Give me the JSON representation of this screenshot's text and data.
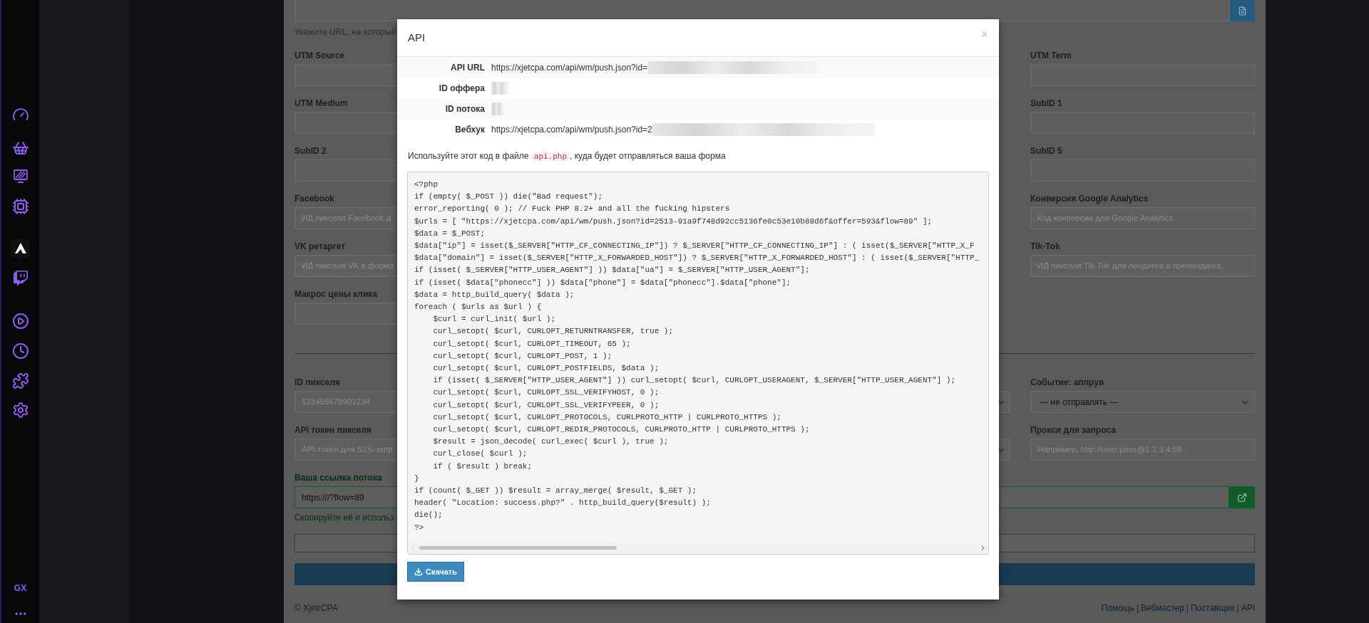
{
  "browser_sidebar": {
    "logo_text": "GX"
  },
  "page": {
    "top_field_hint": "Укажите URL, на который",
    "form_rows": [
      {
        "left": {
          "label": "UTM Source"
        },
        "right": {
          "label": "UTM Term"
        }
      },
      {
        "left": {
          "label": "UTM Medium"
        },
        "right": {
          "label": "SubID 1"
        }
      },
      {
        "left": {
          "label": "SubID 2"
        },
        "right": {
          "label": "SubID 5"
        }
      },
      {
        "left": {
          "label": "Facebook",
          "placeholder": "ИД пикселя Facebook д"
        },
        "right": {
          "label": "Конверсия Google Analytics",
          "placeholder": "Код конверсии для Google Analytics"
        }
      },
      {
        "left": {
          "label": "VK ретаргет",
          "placeholder": "ИД пикселя VK в форма"
        },
        "right": {
          "label": "Tik-Tok",
          "placeholder": "ИД пикселя Tik-Tok для лендинга и прелендинга."
        }
      },
      {
        "left": {
          "label": "Макрос цены клика"
        }
      }
    ],
    "pixel_rows": [
      {
        "left": {
          "label": "ID пикселя",
          "placeholder": "123455678901234"
        },
        "right": {
          "label": "Событие: аппрув",
          "kind": "select",
          "value": "— не отправлять —"
        }
      },
      {
        "left": {
          "label": "API токен пикселя",
          "placeholder": "API-токен для S2S-запр"
        },
        "right": {
          "label": "Прокси для запроса",
          "placeholder": "Например, http://user:pass@1.2.3.4:56"
        }
      }
    ],
    "flow_link": {
      "label": "Ваша ссылка потока",
      "value": "https:///?flow=89",
      "hint": "Скопируйте её и использ"
    },
    "footer": {
      "copyright": "© XjetrCPA",
      "separator": "|",
      "links": [
        "Помощь",
        "Вебмастер",
        "Поставщик",
        "API"
      ]
    }
  },
  "modal": {
    "title": "API",
    "close": "×",
    "fields": [
      {
        "label": "API URL",
        "value": "https://xjetcpa.com/api/wm/push.json?id=",
        "redacted": true
      },
      {
        "label": "ID оффера",
        "redacted": true
      },
      {
        "label": "ID потока",
        "redacted": true
      },
      {
        "label": "Вебхук",
        "value": "https://xjetcpa.com/api/wm/push.json?id=2",
        "redacted": true
      }
    ],
    "instruction": {
      "before": "Используйте этот код в файле",
      "code": "api.php",
      "after": ", куда будет отправляться ваша форма"
    },
    "code_lines": [
      "<?php",
      "if (empty( $_POST )) die(\"Bad request\");",
      "error_reporting( 0 ); // Fuck PHP 8.2+ and all the fucking hipsters",
      "$urls = [ \"https://xjetcpa.com/api/wm/push.json?id=2513-91a9f748d92cc5136fe0c53e10b88d6f&offer=593&flow=89\" ];",
      "$data = $_POST;",
      "$data[\"ip\"] = isset($_SERVER[\"HTTP_CF_CONNECTING_IP\"]) ? $_SERVER[\"HTTP_CF_CONNECTING_IP\"] : ( isset($_SERVER[\"HTTP_X_F",
      "$data[\"domain\"] = isset($_SERVER[\"HTTP_X_FORWARDED_HOST\"]) ? $_SERVER[\"HTTP_X_FORWARDED_HOST\"] : ( isset($_SERVER[\"HTTP_",
      "if (isset( $_SERVER[\"HTTP_USER_AGENT\"] )) $data[\"ua\"] = $_SERVER[\"HTTP_USER_AGENT\"];",
      "if (isset( $data[\"phonecc\"] )) $data[\"phone\"] = $data[\"phonecc\"].$data[\"phone\"];",
      "$data = http_build_query( $data );",
      "foreach ( $urls as $url ) {",
      "\t$curl = curl_init( $url );",
      "\tcurl_setopt( $curl, CURLOPT_RETURNTRANSFER, true );",
      "\tcurl_setopt( $curl, CURLOPT_TIMEOUT, 65 );",
      "\tcurl_setopt( $curl, CURLOPT_POST, 1 );",
      "\tcurl_setopt( $curl, CURLOPT_POSTFIELDS, $data );",
      "\tif (isset( $_SERVER[\"HTTP_USER_AGENT\"] )) curl_setopt( $curl, CURLOPT_USERAGENT, $_SERVER[\"HTTP_USER_AGENT\"] );",
      "\tcurl_setopt( $curl, CURLOPT_SSL_VERIFYHOST, 0 );",
      "\tcurl_setopt( $curl, CURLOPT_SSL_VERIFYPEER, 0 );",
      "\tcurl_setopt( $curl, CURLOPT_PROTOCOLS, CURLPROTO_HTTP | CURLPROTO_HTTPS );",
      "\tcurl_setopt( $curl, CURLOPT_REDIR_PROTOCOLS, CURLPROTO_HTTP | CURLPROTO_HTTPS );",
      "\t$result = json_decode( curl_exec( $curl ), true );",
      "\tcurl_close( $curl );",
      "\tif ( $result ) break;",
      "}",
      "if (count( $_GET )) $result = array_merge( $result, $_GET );",
      "header( \"Location: success.php?\" . http_build_query($result) );",
      "die();",
      "?>"
    ],
    "download_button": "Скачать"
  }
}
